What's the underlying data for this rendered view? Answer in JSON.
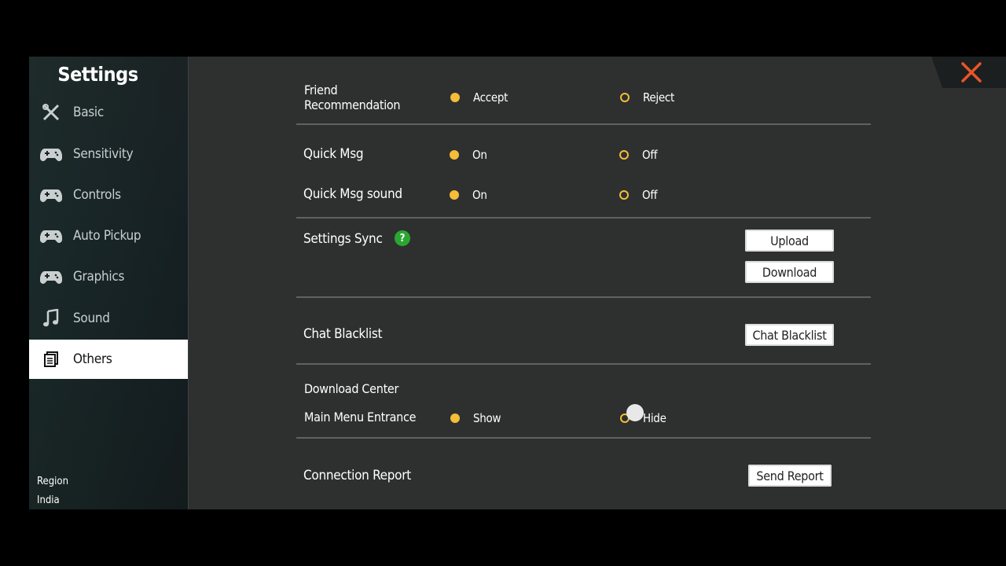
{
  "sidebar": {
    "title": "Settings",
    "items": [
      {
        "label": "Basic",
        "icon": "tools-icon"
      },
      {
        "label": "Sensitivity",
        "icon": "gamepad-icon"
      },
      {
        "label": "Controls",
        "icon": "gamepad-icon"
      },
      {
        "label": "Auto Pickup",
        "icon": "gamepad-icon"
      },
      {
        "label": "Graphics",
        "icon": "gamepad-icon"
      },
      {
        "label": "Sound",
        "icon": "music-note-icon"
      },
      {
        "label": "Others",
        "icon": "document-icon",
        "active": true
      }
    ],
    "region_label": "Region",
    "region_value": "India"
  },
  "settings": {
    "friend_recommendation": {
      "label_line1": "Friend",
      "label_line2": "Recommendation",
      "opt1": "Accept",
      "opt2": "Reject",
      "selected": "Accept"
    },
    "quick_msg": {
      "label": "Quick Msg",
      "opt1": "On",
      "opt2": "Off",
      "selected": "On"
    },
    "quick_msg_sound": {
      "label": "Quick Msg sound",
      "opt1": "On",
      "opt2": "Off",
      "selected": "On"
    },
    "settings_sync": {
      "label": "Settings Sync",
      "help": "?",
      "upload": "Upload",
      "download": "Download"
    },
    "chat_blacklist": {
      "label": "Chat Blacklist",
      "button": "Chat Blacklist"
    },
    "download_center": {
      "label": "Download Center",
      "sub_label": "Main Menu Entrance",
      "opt1": "Show",
      "opt2": "Hide",
      "selected": "Show"
    },
    "connection_report": {
      "label": "Connection Report",
      "button": "Send Report"
    }
  },
  "colors": {
    "accent": "#f5bd38",
    "close": "#e8552a",
    "help": "#2ba631"
  }
}
